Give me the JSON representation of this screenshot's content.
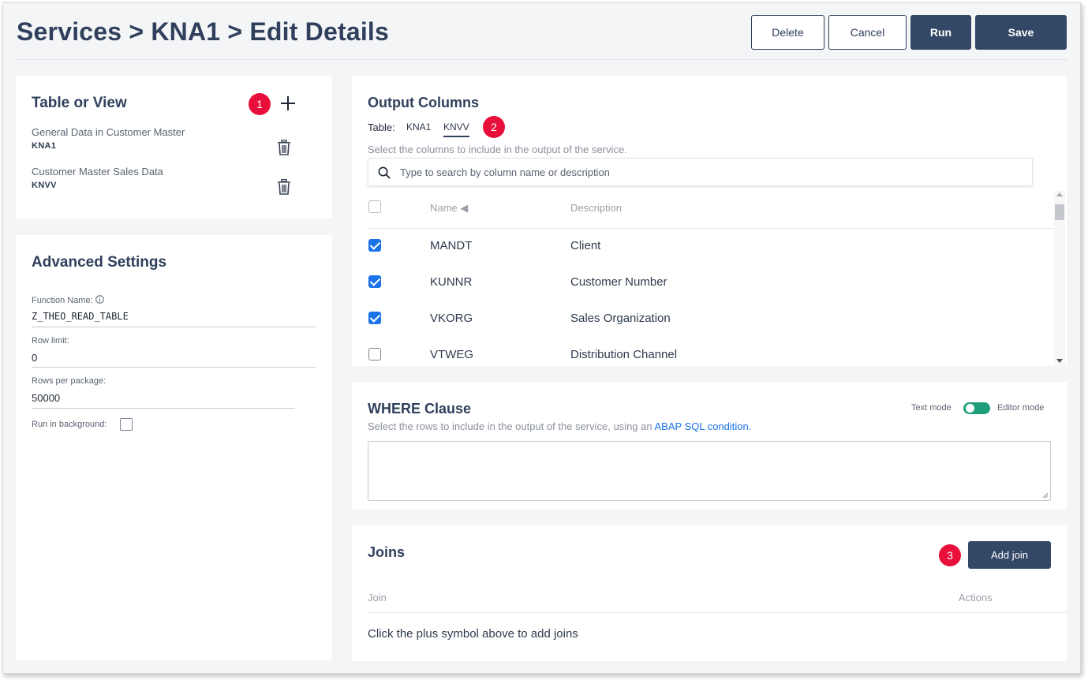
{
  "header": {
    "breadcrumb": "Services > KNA1 > Edit Details",
    "buttons": {
      "delete": "Delete",
      "cancel": "Cancel",
      "run": "Run",
      "save": "Save"
    }
  },
  "table_or_view": {
    "title": "Table or View",
    "badge": "1",
    "items": [
      {
        "label": "General Data in Customer Master",
        "name": "KNA1"
      },
      {
        "label": "Customer Master Sales Data",
        "name": "KNVV"
      }
    ]
  },
  "advanced": {
    "title": "Advanced Settings",
    "function_name_label": "Function Name:",
    "function_name": "Z_THEO_READ_TABLE",
    "row_limit_label": "Row limit:",
    "row_limit": "0",
    "rows_per_package_label": "Rows per package:",
    "rows_per_package": "50000",
    "run_in_background_label": "Run in background:"
  },
  "output_columns": {
    "title": "Output Columns",
    "table_label": "Table:",
    "tabs": [
      "KNA1",
      "KNVV"
    ],
    "active_tab": "KNVV",
    "badge": "2",
    "hint": "Select the columns to include in the output of the service.",
    "search_placeholder": "Type to search by column name or description",
    "col_name": "Name ◀",
    "col_desc": "Description",
    "rows": [
      {
        "name": "MANDT",
        "desc": "Client",
        "checked": true
      },
      {
        "name": "KUNNR",
        "desc": "Customer Number",
        "checked": true
      },
      {
        "name": "VKORG",
        "desc": "Sales Organization",
        "checked": true
      },
      {
        "name": "VTWEG",
        "desc": "Distribution Channel",
        "checked": false
      }
    ]
  },
  "where": {
    "title": "WHERE Clause",
    "text_mode": "Text mode",
    "editor_mode": "Editor mode",
    "hint_prefix": "Select the rows to include in the output of the service, using an",
    "hint_link": "ABAP SQL condition."
  },
  "joins": {
    "title": "Joins",
    "badge": "3",
    "add_button": "Add join",
    "col_join": "Join",
    "col_actions": "Actions",
    "empty": "Click the plus symbol above to add joins"
  },
  "colors": {
    "primary": "#334766",
    "accent": "#1a73e8",
    "badge": "#e8103a",
    "toggle": "#1e9e7a"
  }
}
